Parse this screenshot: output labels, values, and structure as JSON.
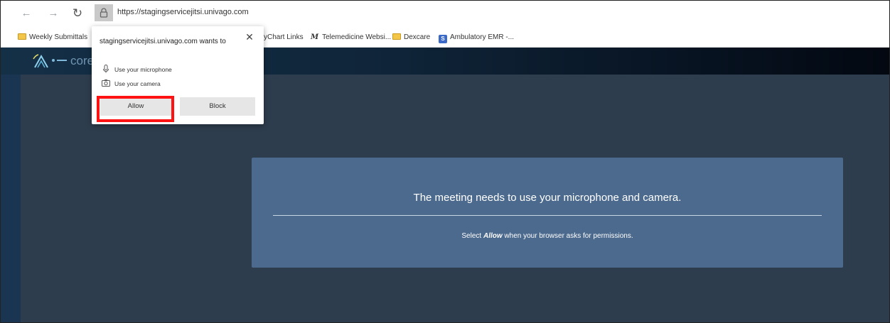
{
  "browser": {
    "url": "https://stagingservicejitsi.univago.com",
    "nav": {
      "back_glyph": "←",
      "forward_glyph": "→",
      "reload_glyph": "↻"
    }
  },
  "bookmarks": [
    {
      "label": "Weekly Submittals",
      "icon": "folder-icon"
    },
    {
      "label": "yChart Links",
      "icon": "none"
    },
    {
      "label": "Telemedicine Websi...",
      "icon": "m-icon"
    },
    {
      "label": "Dexcare",
      "icon": "folder-icon"
    },
    {
      "label": "Ambulatory EMR -...",
      "icon": "sharepoint-icon"
    }
  ],
  "app": {
    "logo_text": "core"
  },
  "popup": {
    "title": "stagingservicejitsi.univago.com wants to",
    "close_glyph": "✕",
    "permissions": [
      {
        "label": "Use your microphone",
        "icon": "microphone-icon"
      },
      {
        "label": "Use your camera",
        "icon": "camera-icon"
      }
    ],
    "allow_label": "Allow",
    "block_label": "Block",
    "highlight_color": "#ff1212"
  },
  "notice": {
    "title": "The meeting needs to use your microphone and camera.",
    "sub_prefix": "Select",
    "sub_emphasis": "Allow",
    "sub_suffix": "when your browser asks for permissions."
  },
  "colors": {
    "app_background": "#2e3d4d",
    "notice_background": "#4c6a8d",
    "header_dark": "#030811"
  }
}
